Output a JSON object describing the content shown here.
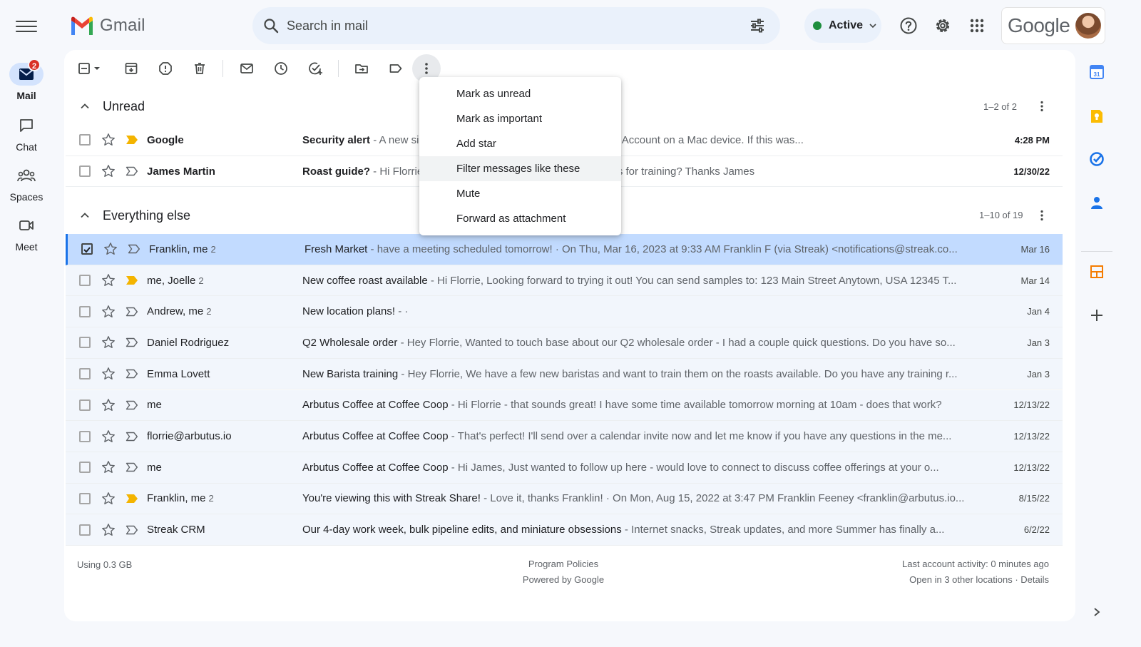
{
  "app": {
    "name": "Gmail"
  },
  "leftnav": {
    "items": [
      {
        "label": "Mail",
        "badge": "2",
        "icon": "mail-icon"
      },
      {
        "label": "Chat",
        "icon": "chat-icon"
      },
      {
        "label": "Spaces",
        "icon": "spaces-icon"
      },
      {
        "label": "Meet",
        "icon": "meet-icon"
      }
    ]
  },
  "search": {
    "placeholder": "Search in mail"
  },
  "status": {
    "label": "Active",
    "color": "#1e8e3e"
  },
  "account": {
    "brand": "Google"
  },
  "sections": {
    "unread": {
      "title": "Unread",
      "count": "1–2 of 2"
    },
    "everything": {
      "title": "Everything else",
      "count": "1–10 of 19"
    }
  },
  "menu": {
    "items": [
      "Mark as unread",
      "Mark as important",
      "Add star",
      "Filter messages like these",
      "Mute",
      "Forward as attachment"
    ]
  },
  "unread_rows": [
    {
      "sender": "Google",
      "count": "",
      "subject": "Security alert",
      "snippet": " - A new sign-in noticed a new sign-in to your Google Account on a Mac device. If this was...",
      "date": "4:28 PM",
      "important": true
    },
    {
      "sender": "James Martin",
      "count": "",
      "subject": "Roast guide?",
      "snippet": " - Hi Florrie, can you share the guide with my baristas for training? Thanks James",
      "date": "12/30/22",
      "important": false
    }
  ],
  "rows": [
    {
      "sender": "Franklin, me",
      "count": "2",
      "subject": "Fresh Market",
      "snippet": " - have a meeting scheduled tomorrow! · On Thu, Mar 16, 2023 at 9:33 AM Franklin F (via Streak) <notifications@streak.co...",
      "date": "Mar 16",
      "important": false,
      "selected": true
    },
    {
      "sender": "me, Joelle",
      "count": "2",
      "subject": "New coffee roast available",
      "snippet": " - Hi Florrie, Looking forward to trying it out! You can send samples to: 123 Main Street Anytown, USA 12345 T...",
      "date": "Mar 14",
      "important": true
    },
    {
      "sender": "Andrew, me",
      "count": "2",
      "subject": "New location plans!",
      "snippet": " - ·",
      "date": "Jan 4",
      "important": false
    },
    {
      "sender": "Daniel Rodriguez",
      "count": "",
      "subject": "Q2 Wholesale order",
      "snippet": " - Hey Florrie, Wanted to touch base about our Q2 wholesale order - I had a couple quick questions. Do you have so...",
      "date": "Jan 3",
      "important": false
    },
    {
      "sender": "Emma Lovett",
      "count": "",
      "subject": "New Barista training",
      "snippet": " - Hey Florrie, We have a few new baristas and want to train them on the roasts available. Do you have any training r...",
      "date": "Jan 3",
      "important": false
    },
    {
      "sender": "me",
      "count": "",
      "subject": "Arbutus Coffee at Coffee Coop",
      "snippet": " - Hi Florrie - that sounds great! I have some time available tomorrow morning at 10am - does that work?",
      "date": "12/13/22",
      "important": false
    },
    {
      "sender": "florrie@arbutus.io",
      "count": "",
      "subject": "Arbutus Coffee at Coffee Coop",
      "snippet": " - That's perfect! I'll send over a calendar invite now and let me know if you have any questions in the me...",
      "date": "12/13/22",
      "important": false
    },
    {
      "sender": "me",
      "count": "",
      "subject": "Arbutus Coffee at Coffee Coop",
      "snippet": " - Hi James, Just wanted to follow up here - would love to connect to discuss coffee offerings at your o...",
      "date": "12/13/22",
      "important": false
    },
    {
      "sender": "Franklin, me",
      "count": "2",
      "subject": "You're viewing this with Streak Share!",
      "snippet": " - Love it, thanks Franklin! · On Mon, Aug 15, 2022 at 3:47 PM Franklin Feeney <franklin@arbutus.io...",
      "date": "8/15/22",
      "important": true
    },
    {
      "sender": "Streak CRM",
      "count": "",
      "subject": "Our 4-day work week, bulk pipeline edits, and miniature obsessions",
      "snippet": " - Internet snacks, Streak updates, and more   Summer has finally a...",
      "date": "6/2/22",
      "important": false
    }
  ],
  "footer": {
    "storage": "Using 0.3 GB",
    "policies": "Program Policies",
    "powered": "Powered by Google",
    "activity": "Last account activity: 0 minutes ago",
    "locations": "Open in 3 other locations · Details"
  },
  "colors": {
    "accent": "#1a73e8",
    "selected_row": "#c2dbff",
    "important": "#f4b400"
  }
}
